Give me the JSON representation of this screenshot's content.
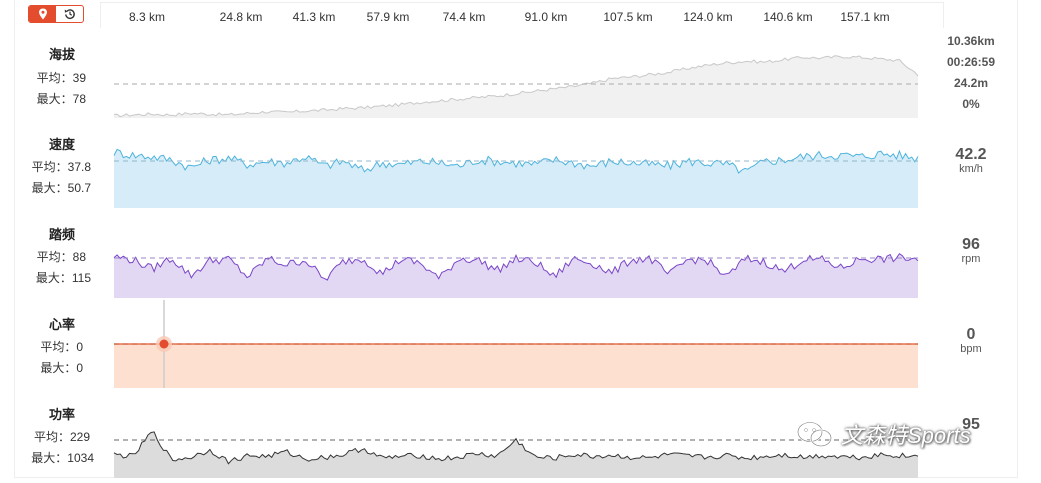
{
  "toolbar": {
    "map_icon": "location-pin-icon",
    "replay_icon": "replay-icon"
  },
  "km_ticks": [
    "8.3 km",
    "24.8 km",
    "41.3 km",
    "57.9 km",
    "74.4 km",
    "91.0 km",
    "107.5 km",
    "124.0 km",
    "140.6 km",
    "157.1 km"
  ],
  "summary": {
    "distance": "10.36km",
    "time": "00:26:59",
    "altitude": "24.2m",
    "grade": "0%"
  },
  "panels": [
    {
      "id": "altitude",
      "title": "海拔",
      "avg_label": "平均：39",
      "max_label": "最大：78",
      "value": "",
      "unit": ""
    },
    {
      "id": "speed",
      "title": "速度",
      "avg_label": "平均：37.8",
      "max_label": "最大：50.7",
      "value": "42.2",
      "unit": "km/h"
    },
    {
      "id": "cadence",
      "title": "踏频",
      "avg_label": "平均：88",
      "max_label": "最大：115",
      "value": "96",
      "unit": "rpm"
    },
    {
      "id": "heartrate",
      "title": "心率",
      "avg_label": "平均：0",
      "max_label": "最大：0",
      "value": "0",
      "unit": "bpm"
    },
    {
      "id": "power",
      "title": "功率",
      "avg_label": "平均：229",
      "max_label": "最大：1034",
      "value": "95",
      "unit": ""
    }
  ],
  "watermark": "文森特Sports",
  "colors": {
    "accent": "#e34c2c",
    "altitude_line": "#c8c8c8",
    "altitude_fill": "#f1f1f1",
    "speed_line": "#4db3dc",
    "speed_fill": "#d6ecf8",
    "cadence_line": "#7a45c8",
    "cadence_fill": "#e2d8f4",
    "hr_line": "#e0592a",
    "hr_fill": "#fde0cf",
    "power_line": "#333333",
    "power_fill": "#dcdcdc"
  },
  "chart_data": {
    "type": "area",
    "x_label_unit": "km",
    "cursor_x": 8.3,
    "x_ticks": [
      8.3,
      24.8,
      41.3,
      57.9,
      74.4,
      91.0,
      107.5,
      124.0,
      140.6,
      157.1
    ],
    "series": [
      {
        "name": "海拔",
        "avg": 39,
        "max": 78,
        "values": [
          3,
          4,
          5,
          4,
          6,
          5,
          4,
          6,
          8,
          7,
          9,
          10,
          12,
          13,
          15,
          17,
          20,
          22,
          24,
          26,
          28,
          31,
          34,
          37,
          40,
          44,
          50,
          52,
          55,
          58,
          63,
          67,
          70,
          72,
          71,
          74,
          77,
          76,
          78,
          77,
          75,
          73,
          55
        ]
      },
      {
        "name": "速度",
        "unit": "km/h",
        "avg": 37.8,
        "max": 50.7,
        "current": 42.2,
        "values": [
          46,
          44,
          43,
          41,
          36,
          41,
          42,
          38,
          40,
          39,
          43,
          37,
          40,
          34,
          39,
          38,
          40,
          39,
          37,
          41,
          40,
          39,
          38,
          41,
          39,
          37,
          40,
          39,
          38,
          37,
          40,
          39,
          38,
          33,
          40,
          41,
          43,
          44,
          44,
          43,
          45,
          44,
          42
        ]
      },
      {
        "name": "踏频",
        "unit": "rpm",
        "avg": 88,
        "max": 115,
        "current": 96,
        "values": [
          100,
          95,
          82,
          98,
          72,
          94,
          96,
          70,
          97,
          88,
          95,
          66,
          93,
          97,
          75,
          96,
          90,
          68,
          97,
          95,
          80,
          96,
          92,
          70,
          97,
          90,
          76,
          95,
          97,
          73,
          96,
          94,
          70,
          97,
          92,
          78,
          96,
          95,
          83,
          97,
          96,
          98,
          96
        ]
      },
      {
        "name": "心率",
        "unit": "bpm",
        "avg": 0,
        "max": 0,
        "current": 0,
        "values": [
          0,
          0,
          0,
          0,
          0,
          0,
          0,
          0,
          0,
          0,
          0,
          0,
          0,
          0,
          0,
          0,
          0,
          0,
          0,
          0,
          0,
          0,
          0,
          0,
          0,
          0,
          0,
          0,
          0,
          0,
          0,
          0,
          0,
          0,
          0,
          0,
          0,
          0,
          0,
          0,
          0,
          0,
          0
        ]
      },
      {
        "name": "功率",
        "avg": 229,
        "max": 1034,
        "current": 95,
        "values": [
          260,
          240,
          520,
          200,
          230,
          310,
          180,
          250,
          240,
          290,
          210,
          230,
          260,
          330,
          220,
          240,
          250,
          210,
          230,
          270,
          240,
          420,
          230,
          220,
          260,
          240,
          250,
          230,
          220,
          260,
          240,
          230,
          250,
          220,
          240,
          260,
          230,
          250,
          240,
          230,
          260,
          250,
          240
        ]
      }
    ]
  }
}
